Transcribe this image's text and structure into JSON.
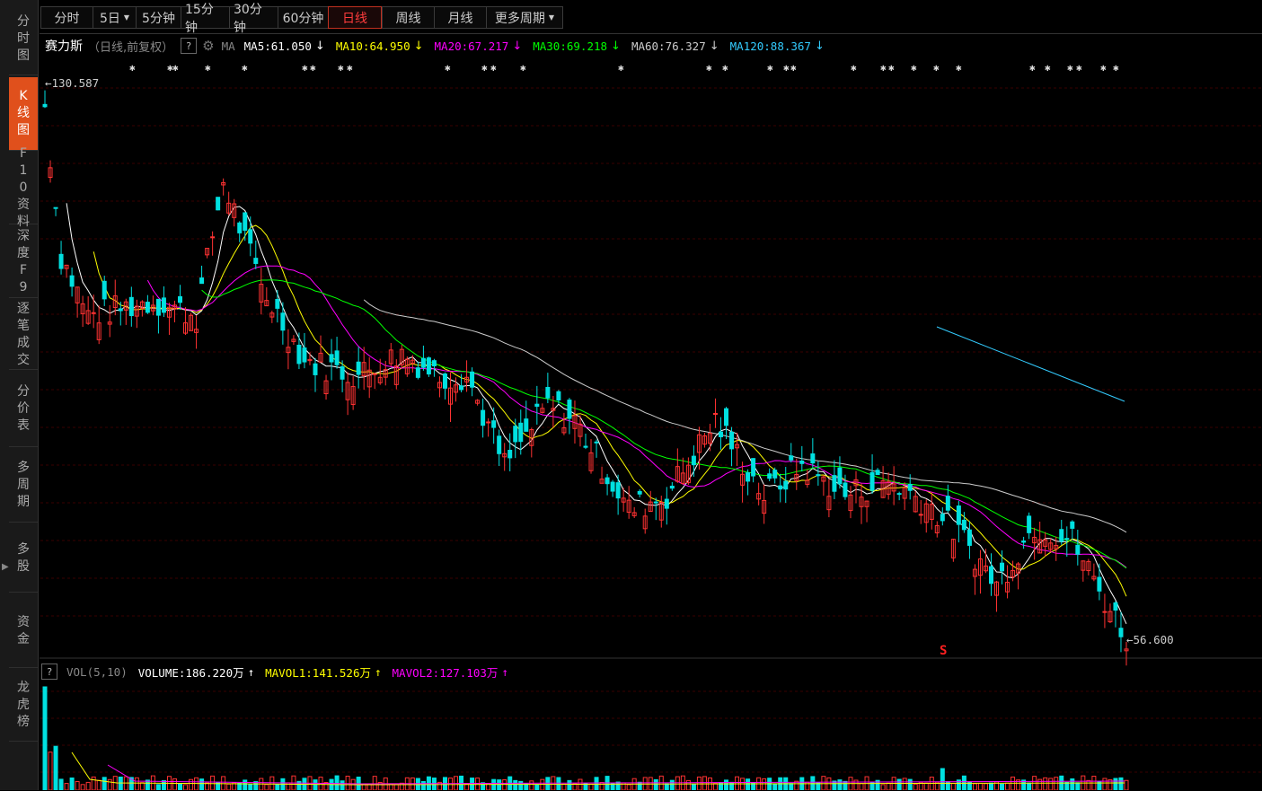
{
  "sidebar": {
    "items": [
      {
        "label": "分时图",
        "active": false
      },
      {
        "label": "K线图",
        "active": true
      },
      {
        "label": "F10资料",
        "active": false
      },
      {
        "label": "深度F9",
        "active": false
      },
      {
        "label": "逐笔成交",
        "active": false
      },
      {
        "label": "分价表",
        "active": false
      },
      {
        "label": "多周期",
        "active": false
      },
      {
        "label": "多股",
        "active": false
      },
      {
        "label": "资金",
        "active": false
      },
      {
        "label": "龙虎榜",
        "active": false
      }
    ]
  },
  "periods": [
    {
      "label": "分时",
      "dropdown": false,
      "active": false
    },
    {
      "label": "5日",
      "dropdown": true,
      "active": false
    },
    {
      "label": "5分钟",
      "dropdown": false,
      "active": false
    },
    {
      "label": "15分钟",
      "dropdown": false,
      "active": false
    },
    {
      "label": "30分钟",
      "dropdown": false,
      "active": false
    },
    {
      "label": "60分钟",
      "dropdown": false,
      "active": false
    },
    {
      "label": "日线",
      "dropdown": false,
      "active": true
    },
    {
      "label": "周线",
      "dropdown": false,
      "active": false
    },
    {
      "label": "月线",
      "dropdown": false,
      "active": false
    },
    {
      "label": "更多周期",
      "dropdown": true,
      "active": false
    }
  ],
  "stock": {
    "name": "赛力斯",
    "period_info": "（日线,前复权）",
    "help": "?",
    "ma_label": "MA",
    "ma_values": [
      {
        "text": "MA5:61.050",
        "color": "#ffffff",
        "arrow": "↓",
        "arrow_color": "#ffffff"
      },
      {
        "text": "MA10:64.950",
        "color": "#ffff00",
        "arrow": "↓",
        "arrow_color": "#ffff00"
      },
      {
        "text": "MA20:67.217",
        "color": "#ff00ff",
        "arrow": "↓",
        "arrow_color": "#ff00ff"
      },
      {
        "text": "MA30:69.218",
        "color": "#00ff00",
        "arrow": "↓",
        "arrow_color": "#00ff00"
      },
      {
        "text": "MA60:76.327",
        "color": "#cccccc",
        "arrow": "↓",
        "arrow_color": "#cccccc"
      },
      {
        "text": "MA120:88.367",
        "color": "#33ccff",
        "arrow": "↓",
        "arrow_color": "#33ccff"
      }
    ]
  },
  "chart_annotations": {
    "high_label": "130.587",
    "low_label": "56.600",
    "signal_marker": "S"
  },
  "volume": {
    "help": "?",
    "indicator": "VOL(5,10)",
    "values": [
      {
        "text": "VOLUME:186.220万",
        "color": "#ffffff",
        "arrow": "↑"
      },
      {
        "text": "MAVOL1:141.526万",
        "color": "#ffff00",
        "arrow": "↑"
      },
      {
        "text": "MAVOL2:127.103万",
        "color": "#ff00ff",
        "arrow": "↑"
      }
    ]
  },
  "colors": {
    "up": "#ff3232",
    "down": "#00e0e0",
    "ma5": "#ffffff",
    "ma10": "#ffff00",
    "ma20": "#ff00ff",
    "ma30": "#00ff00",
    "ma60": "#cccccc",
    "ma120": "#33ccff",
    "grid": "#3a0000"
  },
  "chart_data": {
    "type": "candlestick",
    "price_high": 130.587,
    "price_low": 56.6,
    "latest": {
      "ma5": 61.05,
      "ma10": 64.95,
      "ma20": 67.217,
      "ma30": 69.218,
      "ma60": 76.327,
      "ma120": 88.367,
      "volume_wan": 186.22,
      "mavol1_wan": 141.526,
      "mavol2_wan": 127.103
    }
  }
}
